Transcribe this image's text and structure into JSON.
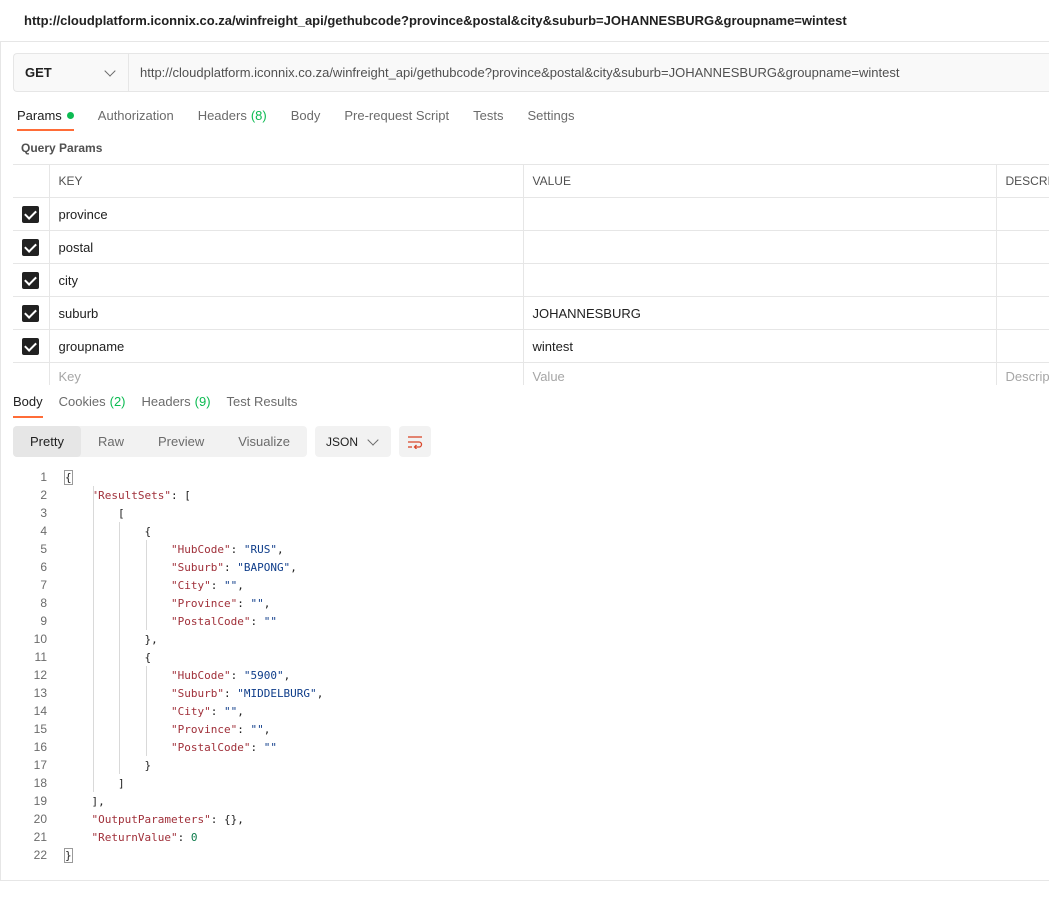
{
  "window": {
    "title": "http://cloudplatform.iconnix.co.za/winfreight_api/gethubcode?province&postal&city&suburb=JOHANNESBURG&groupname=wintest"
  },
  "request": {
    "method": "GET",
    "url": "http://cloudplatform.iconnix.co.za/winfreight_api/gethubcode?province&postal&city&suburb=JOHANNESBURG&groupname=wintest"
  },
  "request_tabs": [
    {
      "label": "Params",
      "active": true,
      "dot": true
    },
    {
      "label": "Authorization"
    },
    {
      "label": "Headers",
      "count": "(8)"
    },
    {
      "label": "Body"
    },
    {
      "label": "Pre-request Script"
    },
    {
      "label": "Tests"
    },
    {
      "label": "Settings"
    }
  ],
  "query_params": {
    "label": "Query Params",
    "headers": [
      "KEY",
      "VALUE",
      "DESCRI"
    ],
    "rows": [
      {
        "key": "province",
        "value": ""
      },
      {
        "key": "postal",
        "value": ""
      },
      {
        "key": "city",
        "value": ""
      },
      {
        "key": "suburb",
        "value": "JOHANNESBURG"
      },
      {
        "key": "groupname",
        "value": "wintest"
      }
    ],
    "placeholders": {
      "key": "Key",
      "value": "Value",
      "description": "Descrip"
    }
  },
  "response_tabs": [
    {
      "label": "Body",
      "active": true
    },
    {
      "label": "Cookies",
      "count": "(2)"
    },
    {
      "label": "Headers",
      "count": "(9)"
    },
    {
      "label": "Test Results"
    }
  ],
  "view_modes": [
    "Pretty",
    "Raw",
    "Preview",
    "Visualize"
  ],
  "active_view": "Pretty",
  "format": "JSON",
  "icons": {
    "wrap": "wrap-lines-icon",
    "chevron": "chevron-down-icon",
    "check": "checkbox-checked-icon"
  },
  "colors": {
    "accent": "#ff6c37",
    "green": "#0cbb52"
  },
  "response_lines": [
    {
      "indent": 0,
      "parts": [
        [
          "p",
          "{"
        ]
      ]
    },
    {
      "indent": 1,
      "parts": [
        [
          "k",
          "\"ResultSets\""
        ],
        [
          "p",
          ": ["
        ]
      ]
    },
    {
      "indent": 2,
      "parts": [
        [
          "p",
          "["
        ]
      ]
    },
    {
      "indent": 3,
      "parts": [
        [
          "p",
          "{"
        ]
      ]
    },
    {
      "indent": 4,
      "parts": [
        [
          "k",
          "\"HubCode\""
        ],
        [
          "p",
          ": "
        ],
        [
          "s",
          "\"RUS\""
        ],
        [
          "p",
          ","
        ]
      ]
    },
    {
      "indent": 4,
      "parts": [
        [
          "k",
          "\"Suburb\""
        ],
        [
          "p",
          ": "
        ],
        [
          "s",
          "\"BAPONG\""
        ],
        [
          "p",
          ","
        ]
      ]
    },
    {
      "indent": 4,
      "parts": [
        [
          "k",
          "\"City\""
        ],
        [
          "p",
          ": "
        ],
        [
          "s",
          "\"\""
        ],
        [
          "p",
          ","
        ]
      ]
    },
    {
      "indent": 4,
      "parts": [
        [
          "k",
          "\"Province\""
        ],
        [
          "p",
          ": "
        ],
        [
          "s",
          "\"\""
        ],
        [
          "p",
          ","
        ]
      ]
    },
    {
      "indent": 4,
      "parts": [
        [
          "k",
          "\"PostalCode\""
        ],
        [
          "p",
          ": "
        ],
        [
          "s",
          "\"\""
        ]
      ]
    },
    {
      "indent": 3,
      "parts": [
        [
          "p",
          "},"
        ]
      ]
    },
    {
      "indent": 3,
      "parts": [
        [
          "p",
          "{"
        ]
      ]
    },
    {
      "indent": 4,
      "parts": [
        [
          "k",
          "\"HubCode\""
        ],
        [
          "p",
          ": "
        ],
        [
          "s",
          "\"5900\""
        ],
        [
          "p",
          ","
        ]
      ]
    },
    {
      "indent": 4,
      "parts": [
        [
          "k",
          "\"Suburb\""
        ],
        [
          "p",
          ": "
        ],
        [
          "s",
          "\"MIDDELBURG\""
        ],
        [
          "p",
          ","
        ]
      ]
    },
    {
      "indent": 4,
      "parts": [
        [
          "k",
          "\"City\""
        ],
        [
          "p",
          ": "
        ],
        [
          "s",
          "\"\""
        ],
        [
          "p",
          ","
        ]
      ]
    },
    {
      "indent": 4,
      "parts": [
        [
          "k",
          "\"Province\""
        ],
        [
          "p",
          ": "
        ],
        [
          "s",
          "\"\""
        ],
        [
          "p",
          ","
        ]
      ]
    },
    {
      "indent": 4,
      "parts": [
        [
          "k",
          "\"PostalCode\""
        ],
        [
          "p",
          ": "
        ],
        [
          "s",
          "\"\""
        ]
      ]
    },
    {
      "indent": 3,
      "parts": [
        [
          "p",
          "}"
        ]
      ]
    },
    {
      "indent": 2,
      "parts": [
        [
          "p",
          "]"
        ]
      ]
    },
    {
      "indent": 1,
      "parts": [
        [
          "p",
          "],"
        ]
      ]
    },
    {
      "indent": 1,
      "parts": [
        [
          "k",
          "\"OutputParameters\""
        ],
        [
          "p",
          ": {},"
        ]
      ]
    },
    {
      "indent": 1,
      "parts": [
        [
          "k",
          "\"ReturnValue\""
        ],
        [
          "p",
          ": "
        ],
        [
          "n",
          "0"
        ]
      ]
    },
    {
      "indent": 0,
      "parts": [
        [
          "p",
          "}"
        ]
      ]
    }
  ]
}
